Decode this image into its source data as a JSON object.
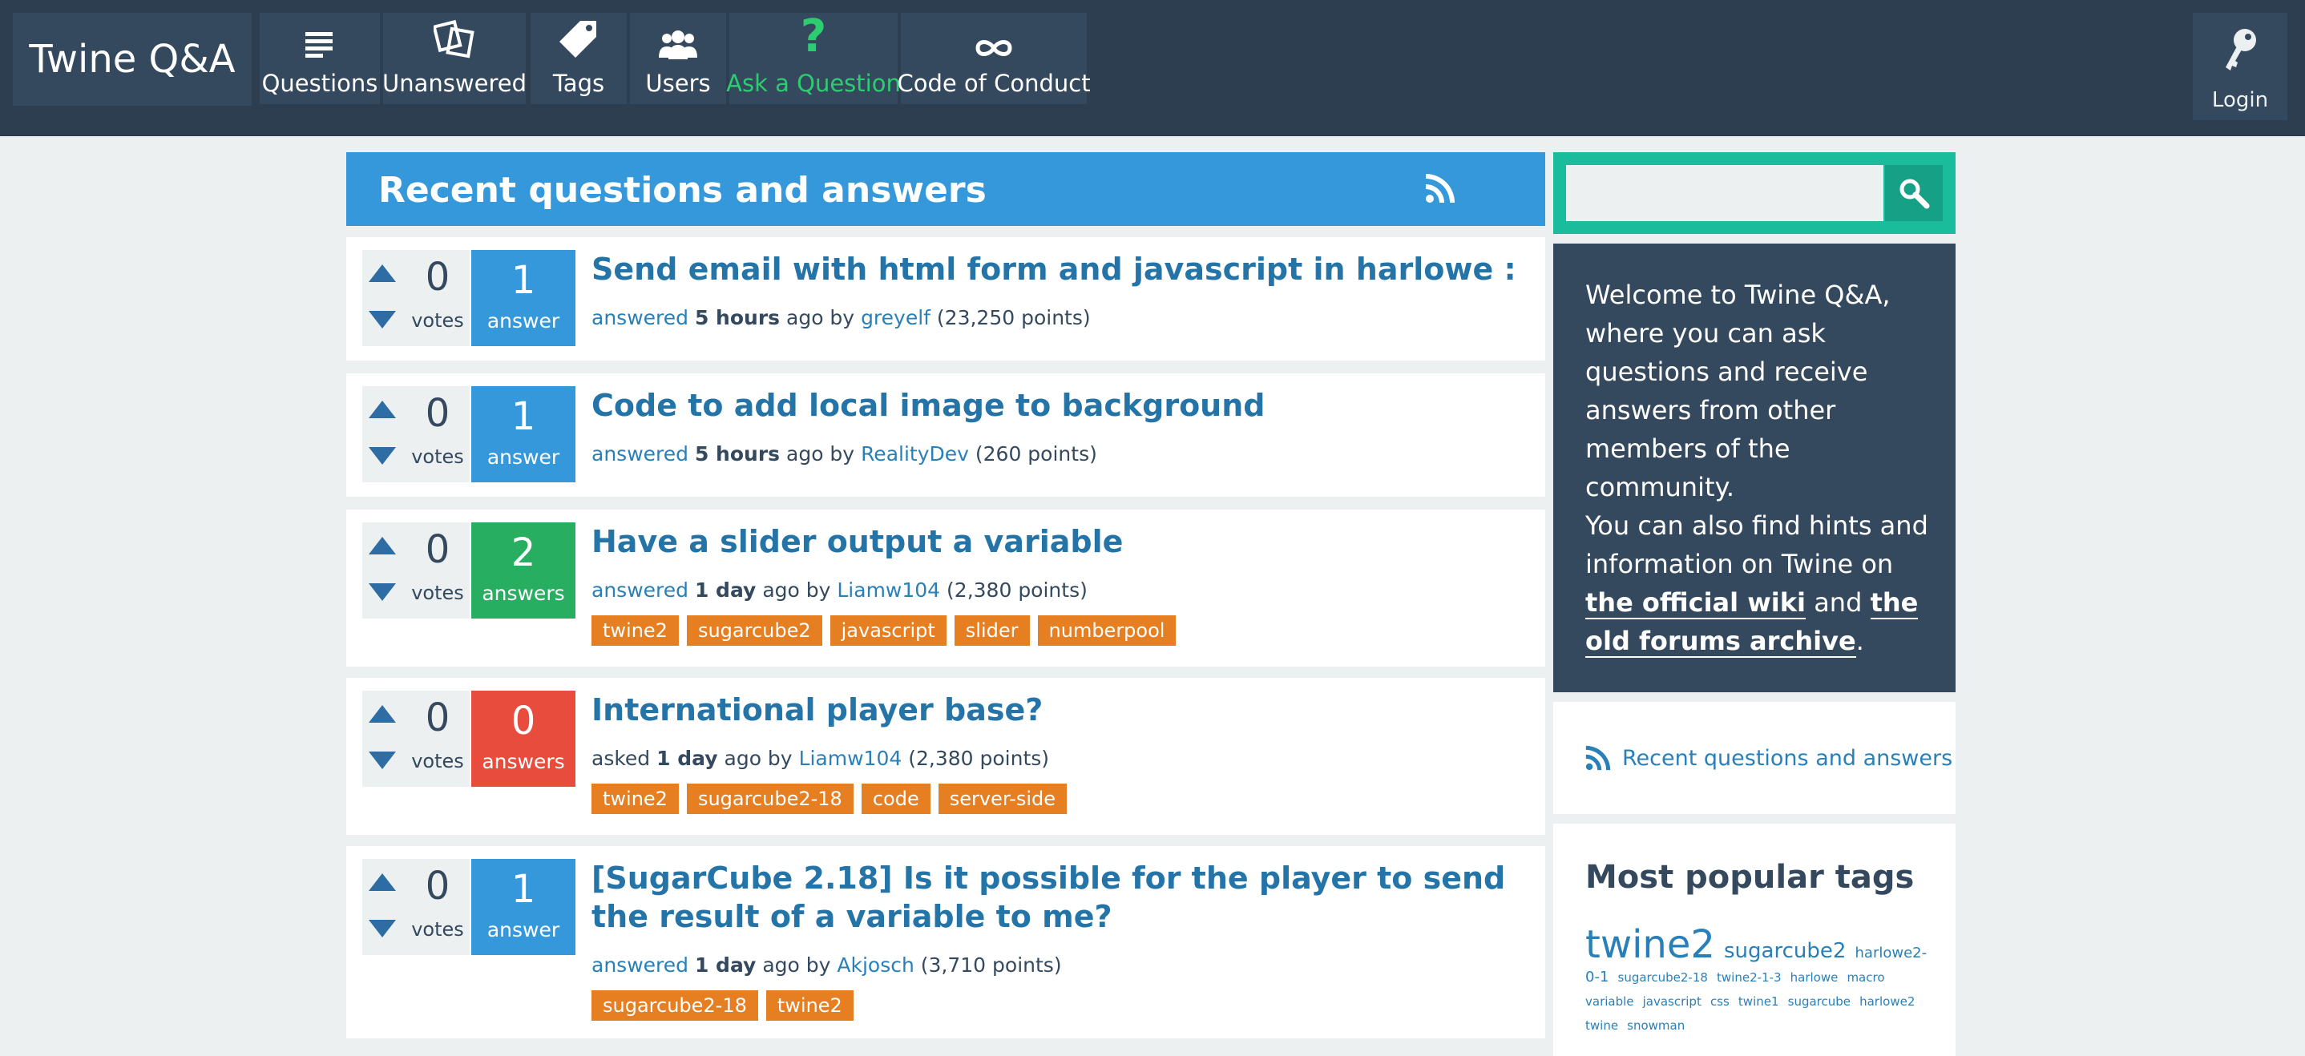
{
  "site": {
    "title": "Twine Q&A"
  },
  "nav": [
    {
      "label": "Questions",
      "icon": "questions-icon"
    },
    {
      "label": "Unanswered",
      "icon": "unanswered-icon"
    },
    {
      "label": "Tags",
      "icon": "tag-icon"
    },
    {
      "label": "Users",
      "icon": "users-icon"
    },
    {
      "label": "Ask a Question",
      "icon": "question-mark-icon"
    },
    {
      "label": "Code of Conduct",
      "icon": "infinity-icon"
    }
  ],
  "login": {
    "label": "Login",
    "icon": "key-icon"
  },
  "main": {
    "heading": "Recent questions and answers"
  },
  "questions": [
    {
      "votes": "0",
      "votes_label": "votes",
      "answers": "1",
      "answers_label": "answer",
      "answer_color": "#3498db",
      "title": "Send email with html form and javascript in harlowe :",
      "action": "answered",
      "when": "5 hours",
      "ago": "ago by",
      "user": "greyelf",
      "points": "(23,250 points)",
      "tags": []
    },
    {
      "votes": "0",
      "votes_label": "votes",
      "answers": "1",
      "answers_label": "answer",
      "answer_color": "#3498db",
      "title": "Code to add local image to background",
      "action": "answered",
      "when": "5 hours",
      "ago": "ago by",
      "user": "RealityDev",
      "points": "(260 points)",
      "tags": []
    },
    {
      "votes": "0",
      "votes_label": "votes",
      "answers": "2",
      "answers_label": "answers",
      "answer_color": "#27ae60",
      "title": "Have a slider output a variable",
      "action": "answered",
      "when": "1 day",
      "ago": "ago by",
      "user": "Liamw104",
      "points": "(2,380 points)",
      "tags": [
        "twine2",
        "sugarcube2",
        "javascript",
        "slider",
        "numberpool"
      ]
    },
    {
      "votes": "0",
      "votes_label": "votes",
      "answers": "0",
      "answers_label": "answers",
      "answer_color": "#e74c3c",
      "title": "International player base?",
      "action": "asked",
      "when": "1 day",
      "ago": "ago by",
      "user": "Liamw104",
      "points": "(2,380 points)",
      "tags": [
        "twine2",
        "sugarcube2-18",
        "code",
        "server-side"
      ]
    },
    {
      "votes": "0",
      "votes_label": "votes",
      "answers": "1",
      "answers_label": "answer",
      "answer_color": "#3498db",
      "title": "[SugarCube 2.18] Is it possible for the player to send the result of a variable to me?",
      "action": "answered",
      "when": "1 day",
      "ago": "ago by",
      "user": "Akjosch",
      "points": "(3,710 points)",
      "tags": [
        "sugarcube2-18",
        "twine2"
      ]
    }
  ],
  "sidebar": {
    "welcome_p1": "Welcome to Twine Q&A, where you can ask questions and receive answers from other members of the community.",
    "welcome_p2_a": "You can also find hints and information on Twine on ",
    "link_wiki": "the official wiki",
    "welcome_p2_b": " and ",
    "link_forums": "the old forums archive",
    "welcome_p2_c": ".",
    "feed_label": "Recent questions and answers",
    "popular_title": "Most popular tags",
    "popular_tags": [
      {
        "t": "twine2",
        "s": 48
      },
      {
        "t": "sugarcube2",
        "s": 26
      },
      {
        "t": "harlowe2-0-1",
        "s": 18
      },
      {
        "t": "sugarcube2-18",
        "s": 15
      },
      {
        "t": "twine2-1-3",
        "s": 15
      },
      {
        "t": "harlowe",
        "s": 15
      },
      {
        "t": "macro",
        "s": 15
      },
      {
        "t": "variable",
        "s": 15
      },
      {
        "t": "javascript",
        "s": 15
      },
      {
        "t": "css",
        "s": 15
      },
      {
        "t": "twine1",
        "s": 15
      },
      {
        "t": "sugarcube",
        "s": 15
      },
      {
        "t": "harlowe2",
        "s": 15
      },
      {
        "t": "twine",
        "s": 15
      },
      {
        "t": "snowman",
        "s": 15
      }
    ]
  },
  "colors": {
    "topbar": "#2c3e50",
    "accent": "#3498db",
    "tag": "#e67e22",
    "search": "#1abc9c"
  }
}
